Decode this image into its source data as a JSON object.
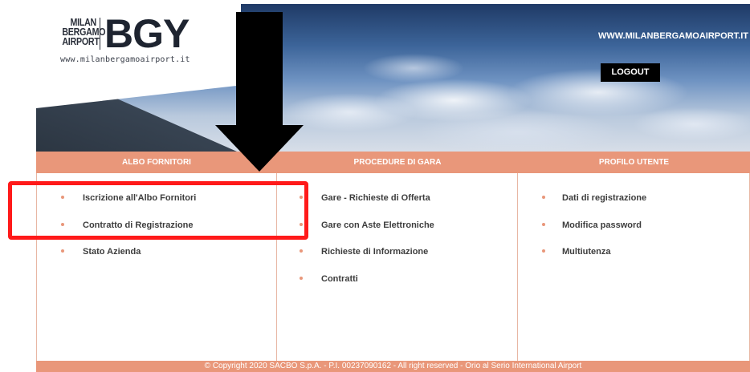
{
  "header": {
    "logo": {
      "line1": "MILAN",
      "line2": "BERGAMO",
      "line3": "AIRPORT",
      "mark": "BGY",
      "url": "www.milanbergamoairport.it"
    },
    "site_link": "WWW.MILANBERGAMOAIRPORT.IT",
    "logout_label": "LOGOUT"
  },
  "columns": [
    {
      "title": "ALBO FORNITORI",
      "items": [
        "Iscrizione all'Albo Fornitori",
        "Contratto di Registrazione",
        "Stato Azienda"
      ]
    },
    {
      "title": "PROCEDURE DI GARA",
      "items": [
        "Gare - Richieste di Offerta",
        "Gare con Aste Elettroniche",
        "Richieste di Informazione",
        "Contratti"
      ]
    },
    {
      "title": "PROFILO UTENTE",
      "items": [
        "Dati di registrazione",
        "Modifica password",
        "Multiutenza"
      ]
    }
  ],
  "footer": {
    "text": "© Copyright 2020 SACBO S.p.A. - P.I. 00237090162 - All right reserved - Orio al Serio International Airport"
  },
  "colors": {
    "accent": "#e9977a",
    "highlight": "#ff1a1a",
    "arrow": "#000000"
  },
  "icons": {
    "annotation_arrow": "arrow-down-icon",
    "bullet": "bullet-icon"
  }
}
